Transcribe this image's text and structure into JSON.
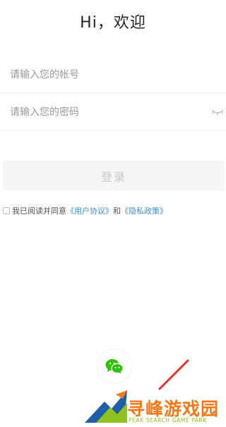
{
  "header": {
    "title": "Hi，欢迎"
  },
  "form": {
    "account_placeholder": "请输入您的帐号",
    "password_placeholder": "请输入您的密码",
    "login_label": "登录"
  },
  "agreement": {
    "prefix": "我已阅读并同意",
    "user_agreement": "《用户协议》",
    "and": "和",
    "privacy_policy": "《隐私政策》"
  },
  "social": {
    "icon": "wechat-icon",
    "brand_color": "#2dc100"
  },
  "watermark": {
    "title": "寻峰游戏园",
    "subtitle": "PEAK SEARCH GAME PARK",
    "colors": {
      "orange": "#f07a1a",
      "green": "#8fc11f",
      "blue": "#1f5fa8",
      "red": "#e8322b"
    }
  }
}
